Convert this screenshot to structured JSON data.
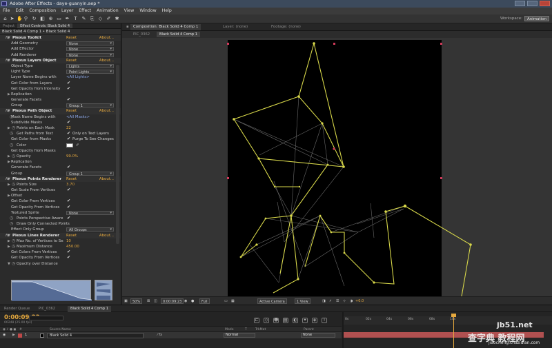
{
  "window": {
    "title": "Adobe After Effects - daye-guanyin.aep *"
  },
  "menu": [
    "File",
    "Edit",
    "Composition",
    "Layer",
    "Effect",
    "Animation",
    "View",
    "Window",
    "Help"
  ],
  "workspace": {
    "label": "Workspace:",
    "value": "Animation"
  },
  "project_panel": {
    "tab_project": "Project",
    "tab_effects": "Effect Controls: Black Solid 4",
    "crumb": "Black Solid 4 Comp 1 • Black Solid 4",
    "reset": "Reset",
    "about": "About..."
  },
  "effects": {
    "toolkit": {
      "name": "Plexus Toolkit",
      "add_geometry": "Add Geometry",
      "add_geometry_val": "None",
      "add_effector": "Add Effector",
      "add_effector_val": "None",
      "add_renderer": "Add Renderer",
      "add_renderer_val": "None"
    },
    "layers_object": {
      "name": "Plexus Layers Object",
      "object_type": "Object Type",
      "object_type_val": "Lights",
      "light_type": "Light Type",
      "light_type_val": "Point Lights",
      "layer_name": "Layer Name Begins with",
      "layer_name_val": "<All Lights>",
      "color_from_layers": "Get Color from Layers",
      "opacity_from_intensity": "Get Opacity from Intensity",
      "replication": "Replication",
      "generate_facets": "Generate Facets",
      "group": "Group",
      "group_val": "Group 1"
    },
    "path_object": {
      "name": "Plexus Path Object",
      "mask_name": "Mask Name Begins with",
      "mask_name_val": "<All Masks>",
      "subdivide": "Subdivide Masks",
      "points_each_mask": "Points on Each Mask",
      "points_each_mask_val": "22",
      "paths_from_text": "Get Paths from Text",
      "only_text_layers": "Only on Text Layers",
      "color_from_masks": "Get Color from Masks",
      "purge": "Purge To See Changes",
      "color": "Color",
      "opacity_from_masks": "Get Opacity from Masks",
      "opacity": "Opacity",
      "opacity_val": "99.0%",
      "replication": "Replication",
      "generate_facets": "Generate Facets",
      "group": "Group",
      "group_val": "Group 1"
    },
    "points_renderer": {
      "name": "Plexus Points Renderer",
      "points_size": "Points Size",
      "points_size_val": "3.70",
      "scale_from_vertices": "Get Scale From Vertices",
      "offset": "Offset",
      "color_from_vertices": "Get Color From Vertices",
      "opacity_from_vertices": "Get Opacity From Vertices",
      "textured_sprite": "Textured Sprite",
      "textured_sprite_val": "None",
      "points_perspective": "Points Perspective Aware",
      "draw_connected": "Draw Only Connected Points",
      "effect_only_group": "Effect Only Group",
      "effect_only_group_val": "All Groups"
    },
    "lines_renderer": {
      "name": "Plexus Lines Renderer",
      "max_vertices": "Max No. of Vertices to Search",
      "max_vertices_val": "10",
      "max_distance": "Maximum Distance",
      "max_distance_val": "450.00",
      "colors_from_vertices": "Get Colors From Vertices",
      "opacity_from_vertices": "Get Opacity From Vertices",
      "opacity_over_distance": "Opacity over Distance"
    }
  },
  "comp_tabs": {
    "composition": "Composition: Black Solid 4 Comp 1",
    "layer": "Layer: (none)",
    "footage": "Footage: (none)"
  },
  "view_tabs": {
    "prev": "PIC_0362",
    "current": "Black Solid 4 Comp 1"
  },
  "viewer_bar": {
    "zoom": "50%",
    "time": "0:00:09:23",
    "resolution": "Full",
    "camera": "Active Camera",
    "views": "1 View",
    "exposure": "+0.0"
  },
  "timeline": {
    "tab_render": "Render Queue",
    "tab_pic": "PIC_0362",
    "tab_comp": "Black Solid 4 Comp 1",
    "timecode": "0:00:09:23",
    "frames": "00248 (25.00 fps)",
    "col_source": "Source Name",
    "col_mode": "Mode",
    "col_trkmat": "TrkMat",
    "col_parent": "Parent",
    "layer_num": "1",
    "layer_name": "Black Solid 4",
    "layer_mode": "Normal",
    "layer_parent": "None",
    "ruler": [
      "0s",
      "02s",
      "04s",
      "06s",
      "08s",
      "10s"
    ]
  },
  "watermark": {
    "brand": "jb51.net",
    "cn": "查字典 教程网",
    "url": "jiaocheng.chazidian.com"
  },
  "colors": {
    "accent": "#e6a93e",
    "plexus_line": "#d8d84a",
    "canvas": "#000000",
    "layer_bar": "#b05050"
  }
}
